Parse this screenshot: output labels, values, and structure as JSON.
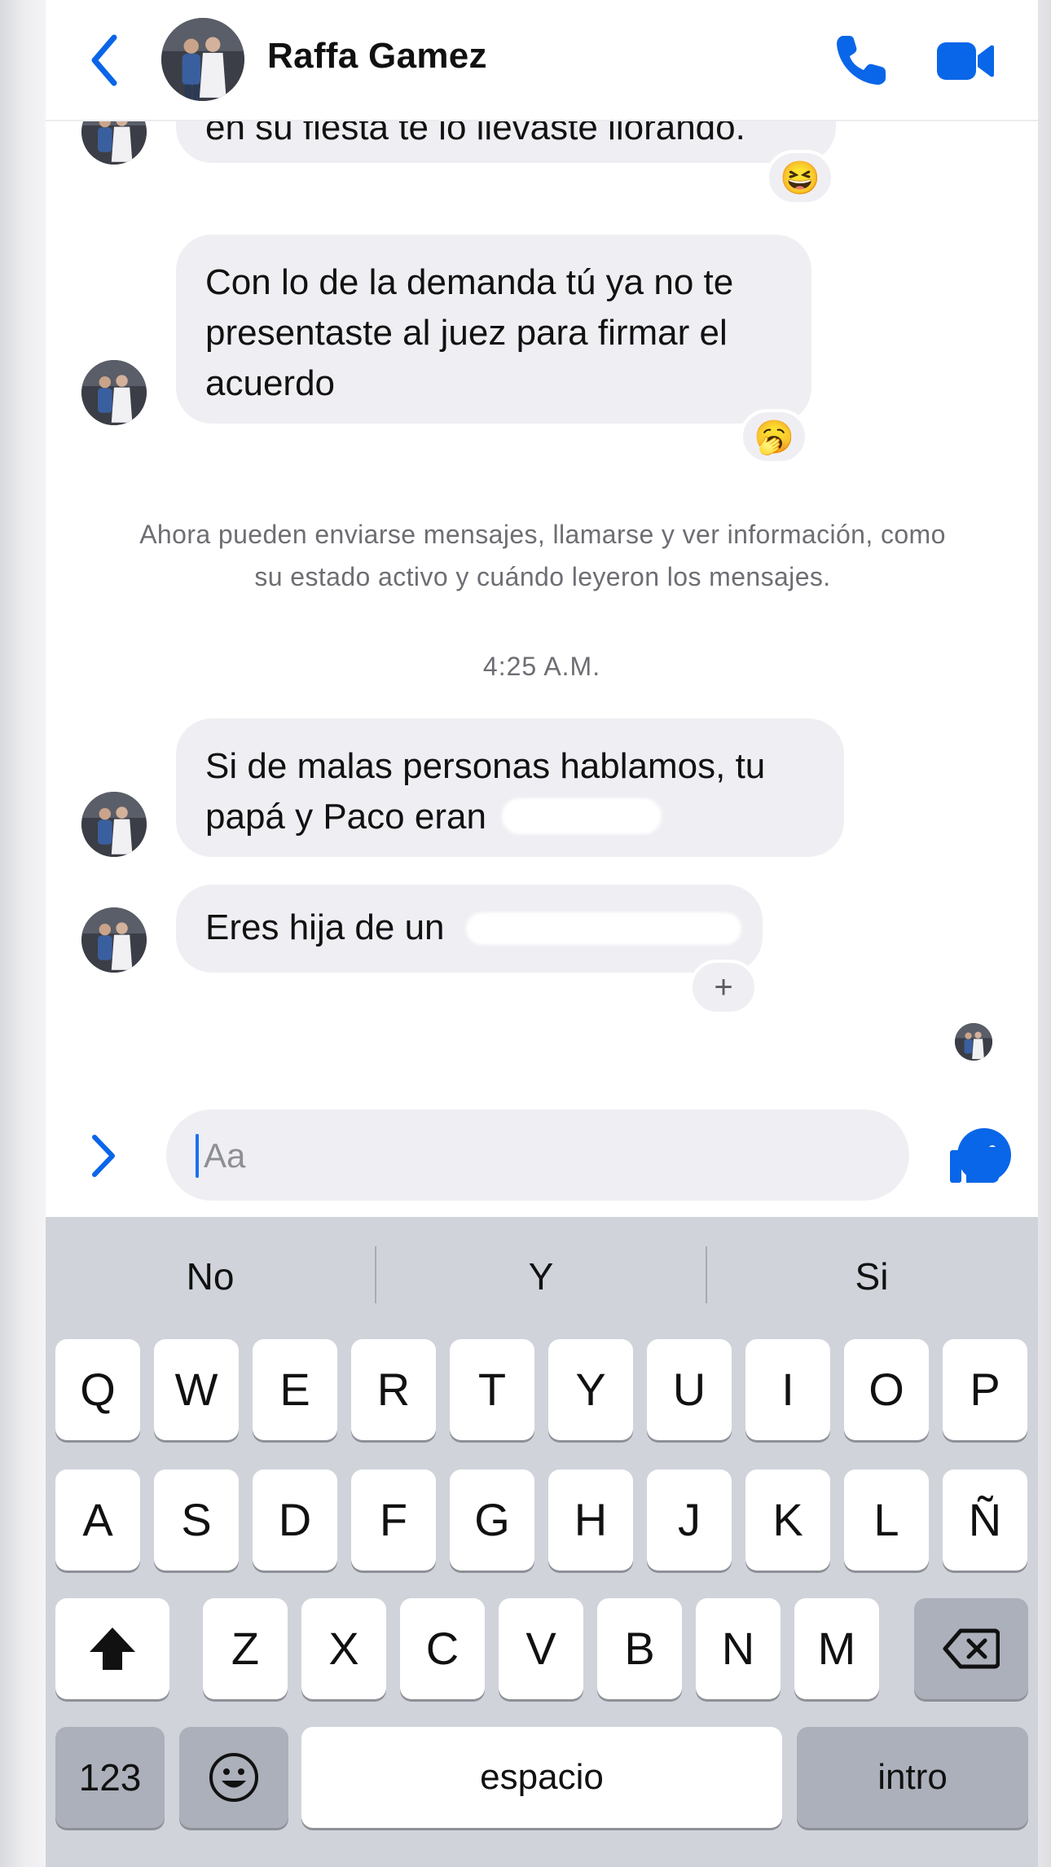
{
  "header": {
    "contact_name": "Raffa Gamez"
  },
  "messages": [
    {
      "text": "en su fiesta te lo llevaste llorando.",
      "reaction": "😆"
    },
    {
      "text": "Con lo de la demanda tú ya no te\npresentaste al juez para firmar el\nacuerdo",
      "reaction": "🥱"
    },
    {
      "text": "Si de malas personas hablamos, tu\npapá y Paco eran"
    },
    {
      "text": "Eres hija de un"
    }
  ],
  "info_note": "Ahora pueden enviarse mensajes, llamarse y ver información, como\nsu estado activo y cuándo leyeron los mensajes.",
  "timestamp": "4:25 A.M.",
  "add_reaction_label": "+",
  "composer": {
    "placeholder": "Aa"
  },
  "keyboard": {
    "predictions": [
      "No",
      "Y",
      "Si"
    ],
    "row1": [
      "Q",
      "W",
      "E",
      "R",
      "T",
      "Y",
      "U",
      "I",
      "O",
      "P"
    ],
    "row2": [
      "A",
      "S",
      "D",
      "F",
      "G",
      "H",
      "J",
      "K",
      "L",
      "Ñ"
    ],
    "row3": [
      "Z",
      "X",
      "C",
      "V",
      "B",
      "N",
      "M"
    ],
    "numbers_label": "123",
    "space_label": "espacio",
    "return_label": "intro"
  },
  "colors": {
    "accent": "#0a66e8",
    "bubble": "#efeff3",
    "keyboard_bg": "#d0d3da"
  }
}
